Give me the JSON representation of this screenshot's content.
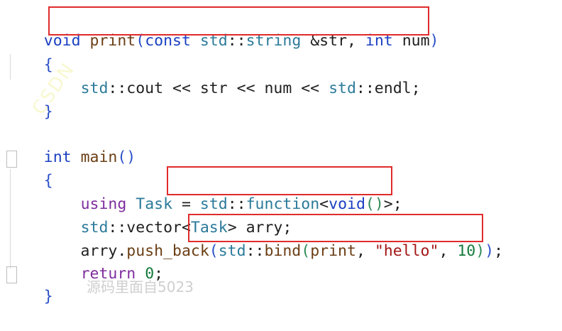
{
  "code": {
    "line1": {
      "t0": "void",
      "t1": " ",
      "t2": "print",
      "t3": "(",
      "t4": "const",
      "t5": " ",
      "t6": "std",
      "t7": "::",
      "t8": "string",
      "t9": " &str, ",
      "t10": "int",
      "t11": " num",
      "t12": ")"
    },
    "line2": {
      "t0": "{"
    },
    "line3": {
      "t0": "    ",
      "t1": "std",
      "t2": "::cout << str << num << ",
      "t3": "std",
      "t4": "::endl;"
    },
    "line4": {
      "t0": "}"
    },
    "line5": {
      "t0": "int",
      "t1": " ",
      "t2": "main",
      "t3": "()"
    },
    "line6": {
      "t0": "{"
    },
    "line7": {
      "t0": "    ",
      "t1": "using",
      "t2": " ",
      "t3": "Task",
      "t4": " = ",
      "t5": "std",
      "t6": "::",
      "t7": "function",
      "t8": "<",
      "t9": "void",
      "t10": "()",
      "t11": ">;"
    },
    "line8": {
      "t0": "    ",
      "t1": "std",
      "t2": "::vector<",
      "t3": "Task",
      "t4": "> arry;"
    },
    "line9": {
      "t0": "    arry.",
      "t1": "push_back",
      "t2": "(",
      "t3": "std",
      "t4": "::",
      "t5": "bind",
      "t6": "(",
      "t7": "print",
      "t8": ", ",
      "t9": "\"hello\"",
      "t10": ", ",
      "t11": "10",
      "t12": ")",
      "t13": ")",
      "t14": ";"
    },
    "line10": {
      "t0": "    ",
      "t1": "return",
      "t2": " ",
      "t3": "0",
      "t4": ";"
    },
    "line11": {
      "t0": "}"
    }
  },
  "watermark": {
    "text": "CSDN"
  },
  "footer": {
    "text": "源码里面自5023"
  },
  "colors": {
    "highlight_box": "#e02b2b",
    "keyword": "#7f2d9e",
    "type": "#2b7a99",
    "function": "#6b3e15",
    "string": "#a31515",
    "number": "#137a3a"
  }
}
